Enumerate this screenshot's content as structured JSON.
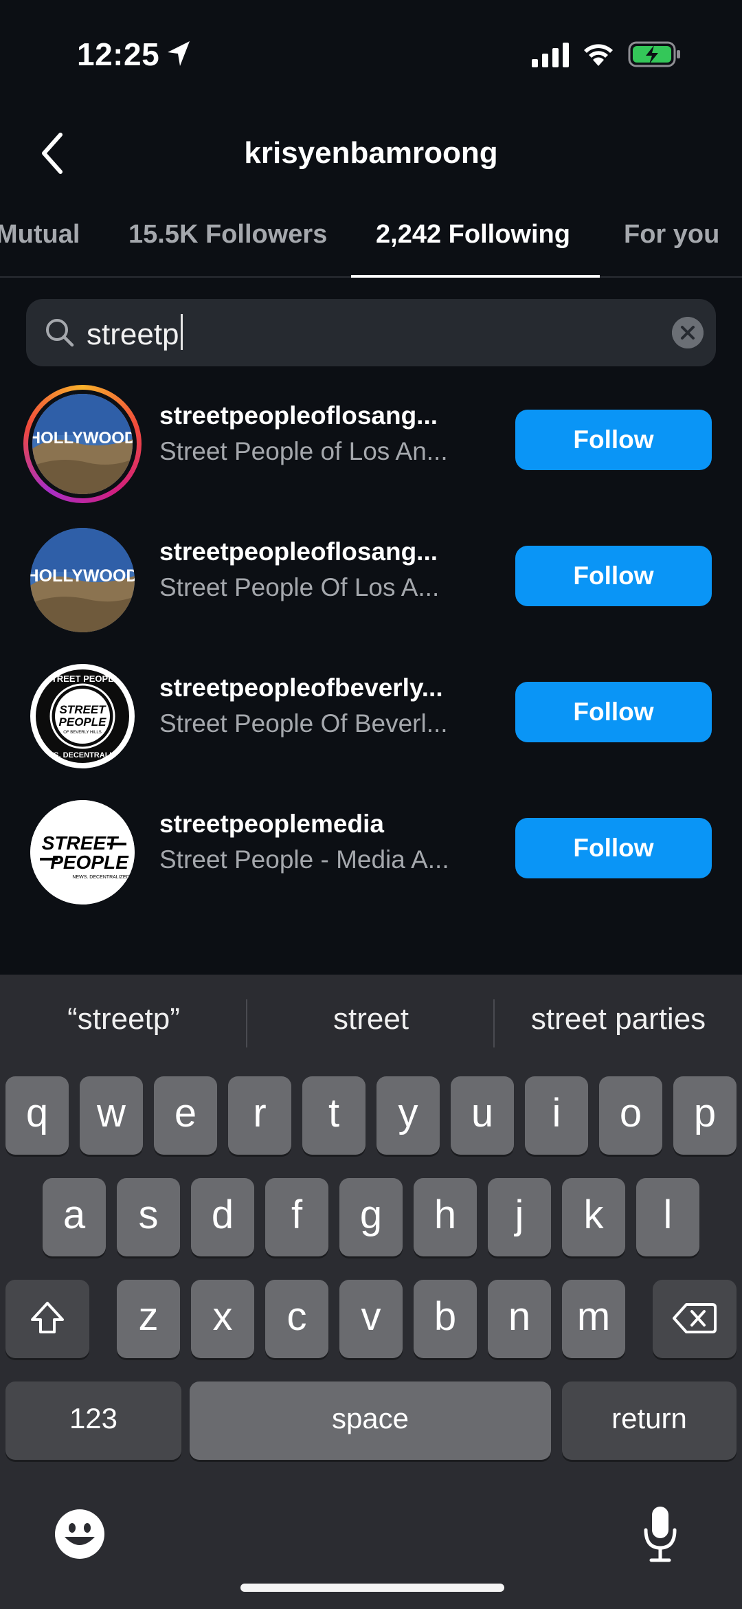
{
  "status": {
    "time": "12:25"
  },
  "header": {
    "title": "krisyenbamroong"
  },
  "tabs": [
    {
      "label": "Mutual"
    },
    {
      "label": "15.5K Followers"
    },
    {
      "label": "2,242 Following"
    },
    {
      "label": "For you"
    }
  ],
  "search": {
    "value": "streetp"
  },
  "results": [
    {
      "username": "streetpeopleoflosang...",
      "fullname": "Street People of Los An...",
      "button": "Follow",
      "avatar_text": "HOLLYWOOD"
    },
    {
      "username": "streetpeopleoflosang...",
      "fullname": "Street People Of Los A...",
      "button": "Follow",
      "avatar_text": "HOLLYWOOD"
    },
    {
      "username": "streetpeopleofbeverly...",
      "fullname": "Street People Of Beverl...",
      "button": "Follow",
      "avatar_text_top": "STREET PEOPLE",
      "avatar_text_mid1": "STREET",
      "avatar_text_mid2": "PEOPLE",
      "avatar_text_sub": "OF BEVERLY HILLS",
      "avatar_text_bottom": "NEWS. DECENTRALIZED."
    },
    {
      "username": "streetpeoplemedia",
      "fullname": "Street People - Media A...",
      "button": "Follow",
      "avatar_text1": "STREET",
      "avatar_text2": "PEOPLE",
      "avatar_text_sub": "NEWS. DECENTRALIZED."
    }
  ],
  "keyboard": {
    "suggestions": [
      "“streetp”",
      "street",
      "street parties"
    ],
    "row1": [
      "q",
      "w",
      "e",
      "r",
      "t",
      "y",
      "u",
      "i",
      "o",
      "p"
    ],
    "row2": [
      "a",
      "s",
      "d",
      "f",
      "g",
      "h",
      "j",
      "k",
      "l"
    ],
    "row3": [
      "z",
      "x",
      "c",
      "v",
      "b",
      "n",
      "m"
    ],
    "numbers_label": "123",
    "space_label": "space",
    "return_label": "return"
  },
  "colors": {
    "accent": "#0a95f6",
    "background": "#0c0f14",
    "keyboard": "#2b2c31"
  }
}
